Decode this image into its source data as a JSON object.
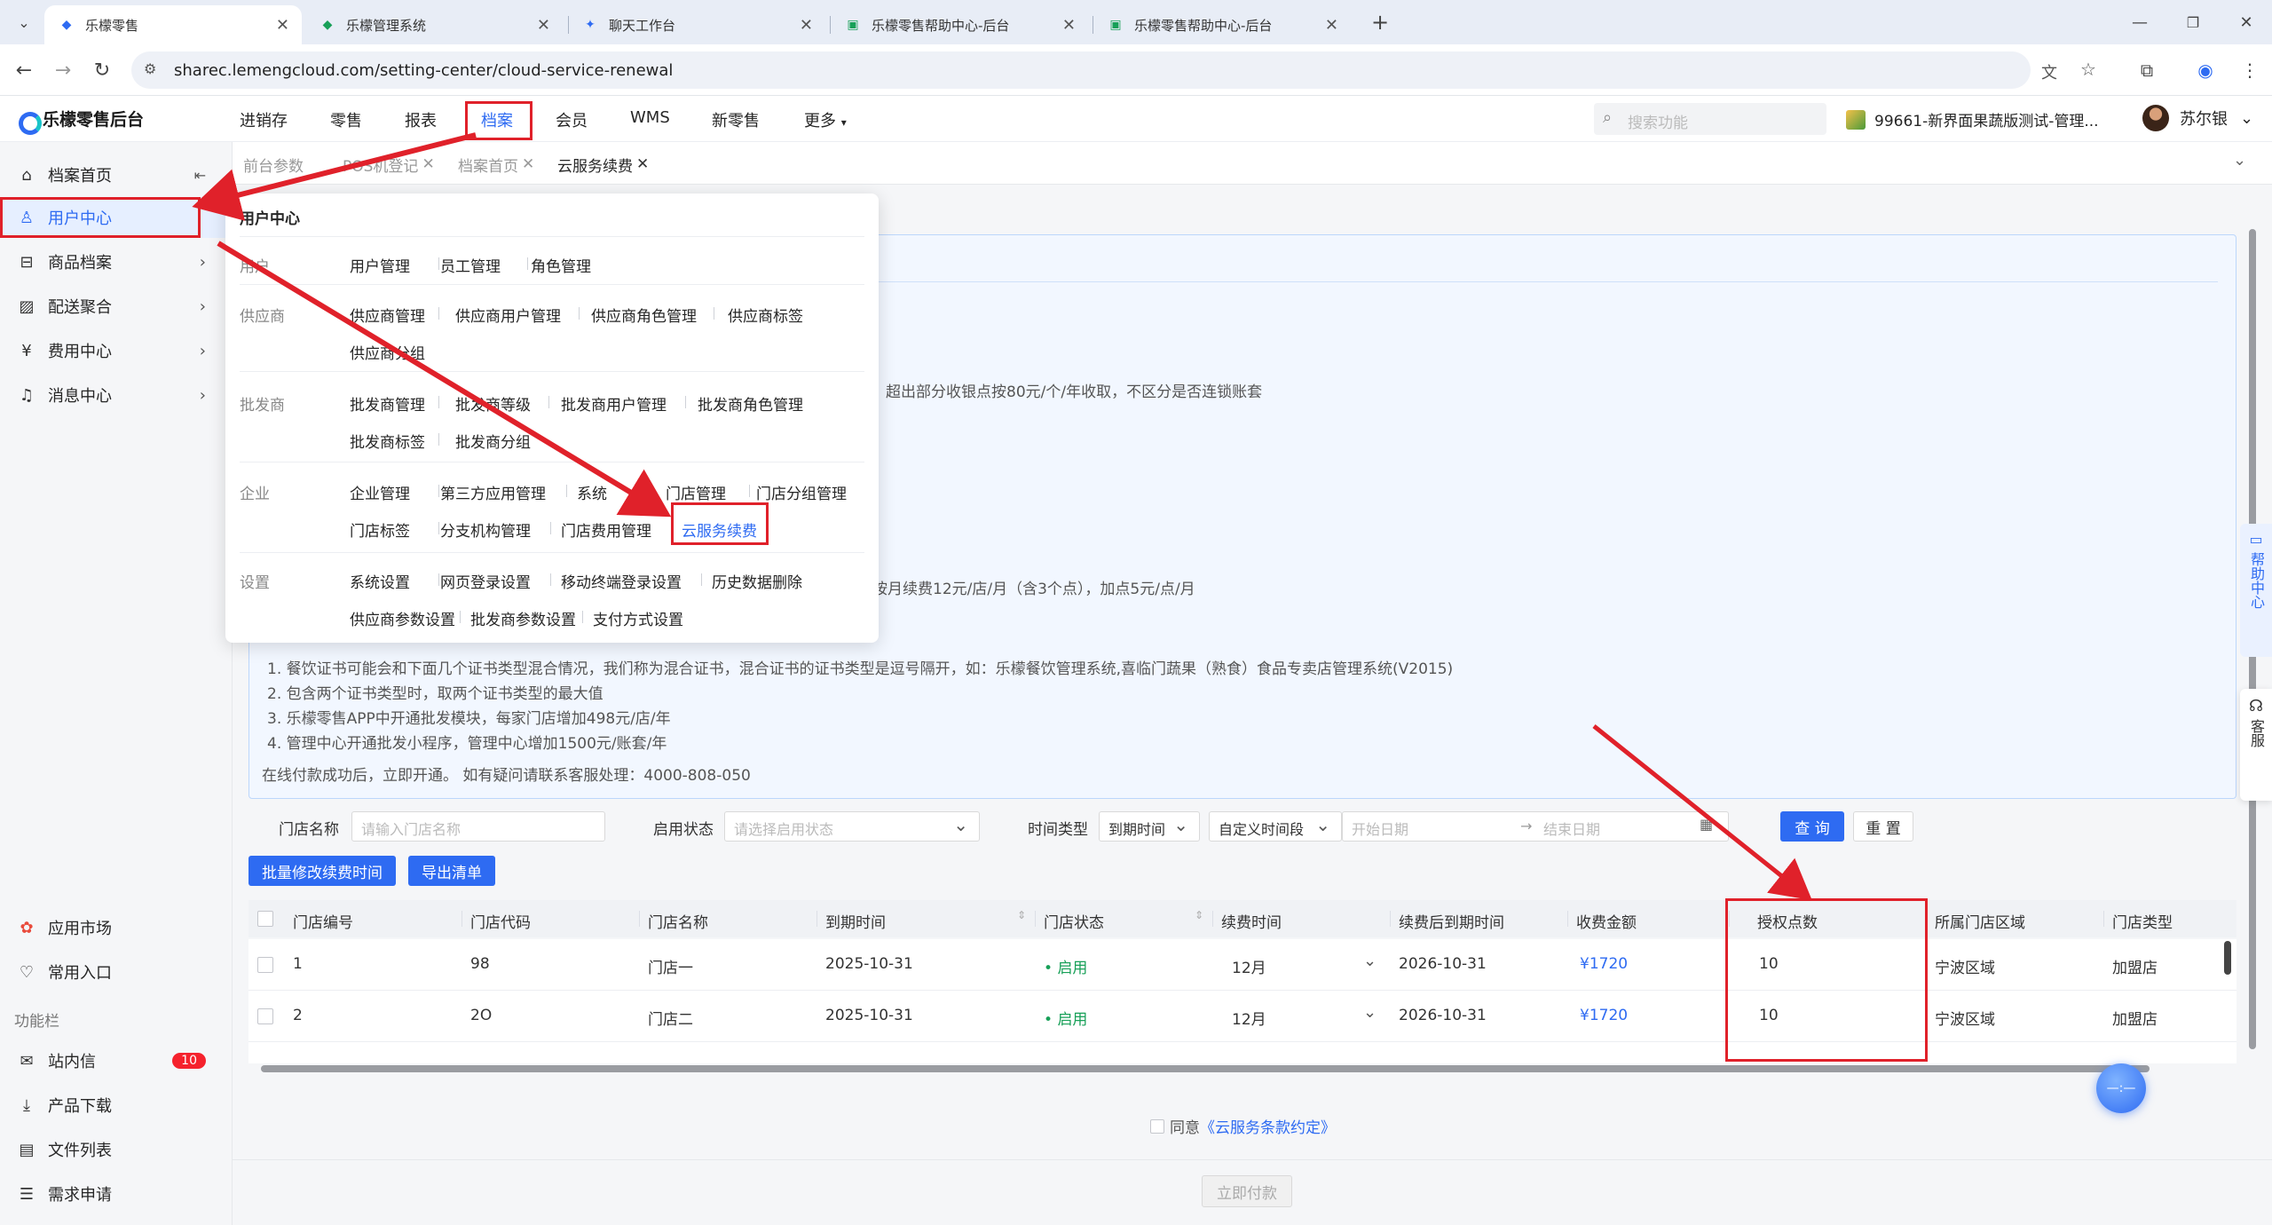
{
  "browser": {
    "tabs": [
      {
        "title": "乐檬零售"
      },
      {
        "title": "乐檬管理系统"
      },
      {
        "title": "聊天工作台"
      },
      {
        "title": "乐檬零售帮助中心-后台"
      },
      {
        "title": "乐檬零售帮助中心-后台"
      }
    ],
    "new_tab": "+",
    "url": "sharec.lemengcloud.com/setting-center/cloud-service-renewal"
  },
  "app": {
    "logo": "乐檬零售后台",
    "nav": [
      "进销存",
      "零售",
      "报表",
      "档案",
      "会员",
      "WMS",
      "新零售",
      "更多"
    ],
    "search_placeholder": "搜索功能",
    "shop": "99661-新界面果蔬版测试-管理...",
    "user": "苏尔银"
  },
  "sidebar": {
    "items": [
      {
        "label": "档案首页",
        "icon": "home-icon"
      },
      {
        "label": "用户中心",
        "icon": "user-icon"
      },
      {
        "label": "商品档案",
        "icon": "goods-icon"
      },
      {
        "label": "配送聚合",
        "icon": "delivery-icon"
      },
      {
        "label": "费用中心",
        "icon": "yen-icon"
      },
      {
        "label": "消息中心",
        "icon": "bell-icon"
      }
    ],
    "bottom_items": [
      {
        "label": "应用市场"
      },
      {
        "label": "常用入口"
      }
    ],
    "section_label": "功能栏",
    "function_items": [
      {
        "label": "站内信",
        "badge": "10"
      },
      {
        "label": "产品下载"
      },
      {
        "label": "文件列表"
      },
      {
        "label": "需求申请"
      }
    ]
  },
  "page_tabs": [
    "前台参数",
    "POS机登记",
    "档案首页",
    "云服务续费"
  ],
  "dropdown": {
    "title": "用户中心",
    "groups": [
      {
        "name": "用户",
        "items": [
          "用户管理",
          "员工管理",
          "角色管理"
        ]
      },
      {
        "name": "供应商",
        "items": [
          "供应商管理",
          "供应商用户管理",
          "供应商角色管理",
          "供应商标签",
          "供应商分组"
        ]
      },
      {
        "name": "批发商",
        "items": [
          "批发商管理",
          "批发商等级",
          "批发商用户管理",
          "批发商角色管理",
          "批发商标签",
          "批发商分组"
        ]
      },
      {
        "name": "企业",
        "items": [
          "企业管理",
          "第三方应用管理",
          "系统",
          "门店管理",
          "门店分组管理",
          "门店标签",
          "分支机构管理",
          "门店费用管理",
          "云服务续费"
        ]
      },
      {
        "name": "设置",
        "items": [
          "系统设置",
          "网页登录设置",
          "移动终端登录设置",
          "历史数据删除",
          "供应商参数设置",
          "批发商参数设置",
          "支付方式设置"
        ]
      }
    ]
  },
  "notice": {
    "line_a": "，超出部分收银点按80元/个/年收取，不区分是否连锁账套",
    "line_b": "按月续费12元/店/月（含3个点），加点5元/点/月",
    "notes": [
      "1. 餐饮证书可能会和下面几个证书类型混合情况，我们称为混合证书，混合证书的证书类型是逗号隔开，如：乐檬餐饮管理系统,喜临门蔬果（熟食）食品专卖店管理系统(V2015)",
      "2. 包含两个证书类型时，取两个证书类型的最大值",
      "3. 乐檬零售APP中开通批发模块，每家门店增加498元/店/年",
      "4. 管理中心开通批发小程序，管理中心增加1500元/账套/年"
    ],
    "contact": "在线付款成功后，立即开通。 如有疑问请联系客服处理：4000-808-050"
  },
  "filters": {
    "store_name_label": "门店名称",
    "store_name_placeholder": "请输入门店名称",
    "status_label": "启用状态",
    "status_placeholder": "请选择启用状态",
    "time_type_label": "时间类型",
    "time_type_value": "到期时间",
    "period_value": "自定义时间段",
    "start_placeholder": "开始日期",
    "range_sep": "→",
    "end_placeholder": "结束日期",
    "query": "查 询",
    "reset": "重 置"
  },
  "actions": {
    "batch": "批量修改续费时间",
    "export": "导出清单"
  },
  "table": {
    "columns": [
      "门店编号",
      "门店代码",
      "门店名称",
      "到期时间",
      "门店状态",
      "续费时间",
      "续费后到期时间",
      "收费金额",
      "授权点数",
      "所属门店区域",
      "门店类型"
    ],
    "rows": [
      [
        "1",
        "98",
        "门店一",
        "2025-10-31",
        "启用",
        "12月",
        "2026-10-31",
        "¥1720",
        "10",
        "宁波区域",
        "加盟店"
      ],
      [
        "2",
        "2O",
        "门店二",
        "2025-10-31",
        "启用",
        "12月",
        "2026-10-31",
        "¥1720",
        "10",
        "宁波区域",
        "加盟店"
      ]
    ]
  },
  "footer": {
    "agree_prefix": "同意",
    "agree_link": "《云服务条款约定》",
    "pay": "立即付款"
  },
  "floating": {
    "help": "帮助中心",
    "service": "客服",
    "ball": "—:—"
  },
  "colors": {
    "primary": "#2e6bf2",
    "annotation_red": "#e0212a",
    "status_green": "#18a058"
  }
}
